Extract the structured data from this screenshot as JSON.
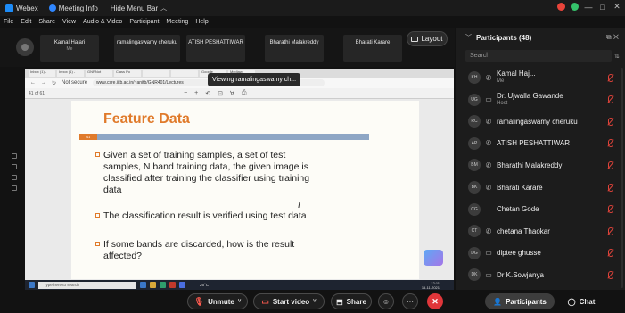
{
  "titlebar": {
    "app": "Webex",
    "meeting_info": "Meeting Info",
    "hide_menu": "Hide Menu Bar",
    "hide_menu_icon": "chevron-up-icon",
    "window_controls": [
      "—",
      "□",
      "✕"
    ]
  },
  "menubar": [
    "File",
    "Edit",
    "Share",
    "View",
    "Audio & Video",
    "Participant",
    "Meeting",
    "Help"
  ],
  "strip": {
    "tiles": [
      {
        "name": "Kamal Hajari",
        "sub": "Me"
      },
      {
        "name": "ramalingaswamy cheruku",
        "sub": ""
      },
      {
        "name": "ATISH PESHATTIWAR",
        "sub": ""
      },
      {
        "name": "Bharathi Malakreddy",
        "sub": ""
      },
      {
        "name": "Bharati Karare",
        "sub": ""
      }
    ],
    "layout_label": "Layout"
  },
  "share": {
    "viewing_label": "Viewing ramalingaswamy ch...",
    "url_warning": "Not secure",
    "url": "www.csre.iitb.ac.in/~anitb/GNR401/Lectures",
    "browser_tabs": [
      "Inbox (1) - ",
      "Inbox (1) - ",
      "GNRNot",
      "Class Po",
      "",
      "",
      "Google",
      "Mediaw"
    ],
    "page_indicator": "41 of 61",
    "slide": {
      "title": "Feature Data",
      "number": "41",
      "bullets": [
        [
          "Given a set of training samples, a set of test",
          "samples, N band training data, the given image is",
          "classified after training the classifier using training",
          "data"
        ],
        [
          "The classification result is verified using test data"
        ],
        [
          "If some bands are discarded, how is the result",
          "affected?"
        ]
      ]
    },
    "taskbar_search": "Type here to search",
    "taskbar_weather": "26°C",
    "taskbar_time": "12:11",
    "taskbar_date": "15-11-2021"
  },
  "panel": {
    "title": "Participants (48)",
    "search_placeholder": "Search",
    "participants": [
      {
        "initials": "KH",
        "name": "Kamal Haj...",
        "role": "Me",
        "status_icon": "phone-icon"
      },
      {
        "initials": "UG",
        "name": "Dr. Ujwalla Gawande",
        "role": "Host",
        "status_icon": "monitor-icon"
      },
      {
        "initials": "RC",
        "name": "ramalingaswamy cheruku",
        "role": "",
        "status_icon": "phone-icon"
      },
      {
        "initials": "AP",
        "name": "ATISH PESHATTIWAR",
        "role": "",
        "status_icon": "phone-icon"
      },
      {
        "initials": "BM",
        "name": "Bharathi Malakreddy",
        "role": "",
        "status_icon": "phone-icon"
      },
      {
        "initials": "BK",
        "name": "Bharati Karare",
        "role": "",
        "status_icon": "phone-icon"
      },
      {
        "initials": "CG",
        "name": "Chetan Gode",
        "role": "",
        "status_icon": ""
      },
      {
        "initials": "CT",
        "name": "chetana Thaokar",
        "role": "",
        "status_icon": "phone-icon"
      },
      {
        "initials": "DG",
        "name": "diptee ghusse",
        "role": "",
        "status_icon": "monitor-icon"
      },
      {
        "initials": "DK",
        "name": "Dr K.Sowjanya",
        "role": "",
        "status_icon": "monitor-icon"
      }
    ]
  },
  "controls": {
    "unmute": "Unmute",
    "start_video": "Start video",
    "share": "Share",
    "participants": "Participants",
    "chat": "Chat"
  },
  "colors": {
    "accent_orange": "#e07a2b",
    "leave_red": "#e0363a",
    "muted_red": "#ff5a4f",
    "slide_band": "#8ea6c5"
  }
}
